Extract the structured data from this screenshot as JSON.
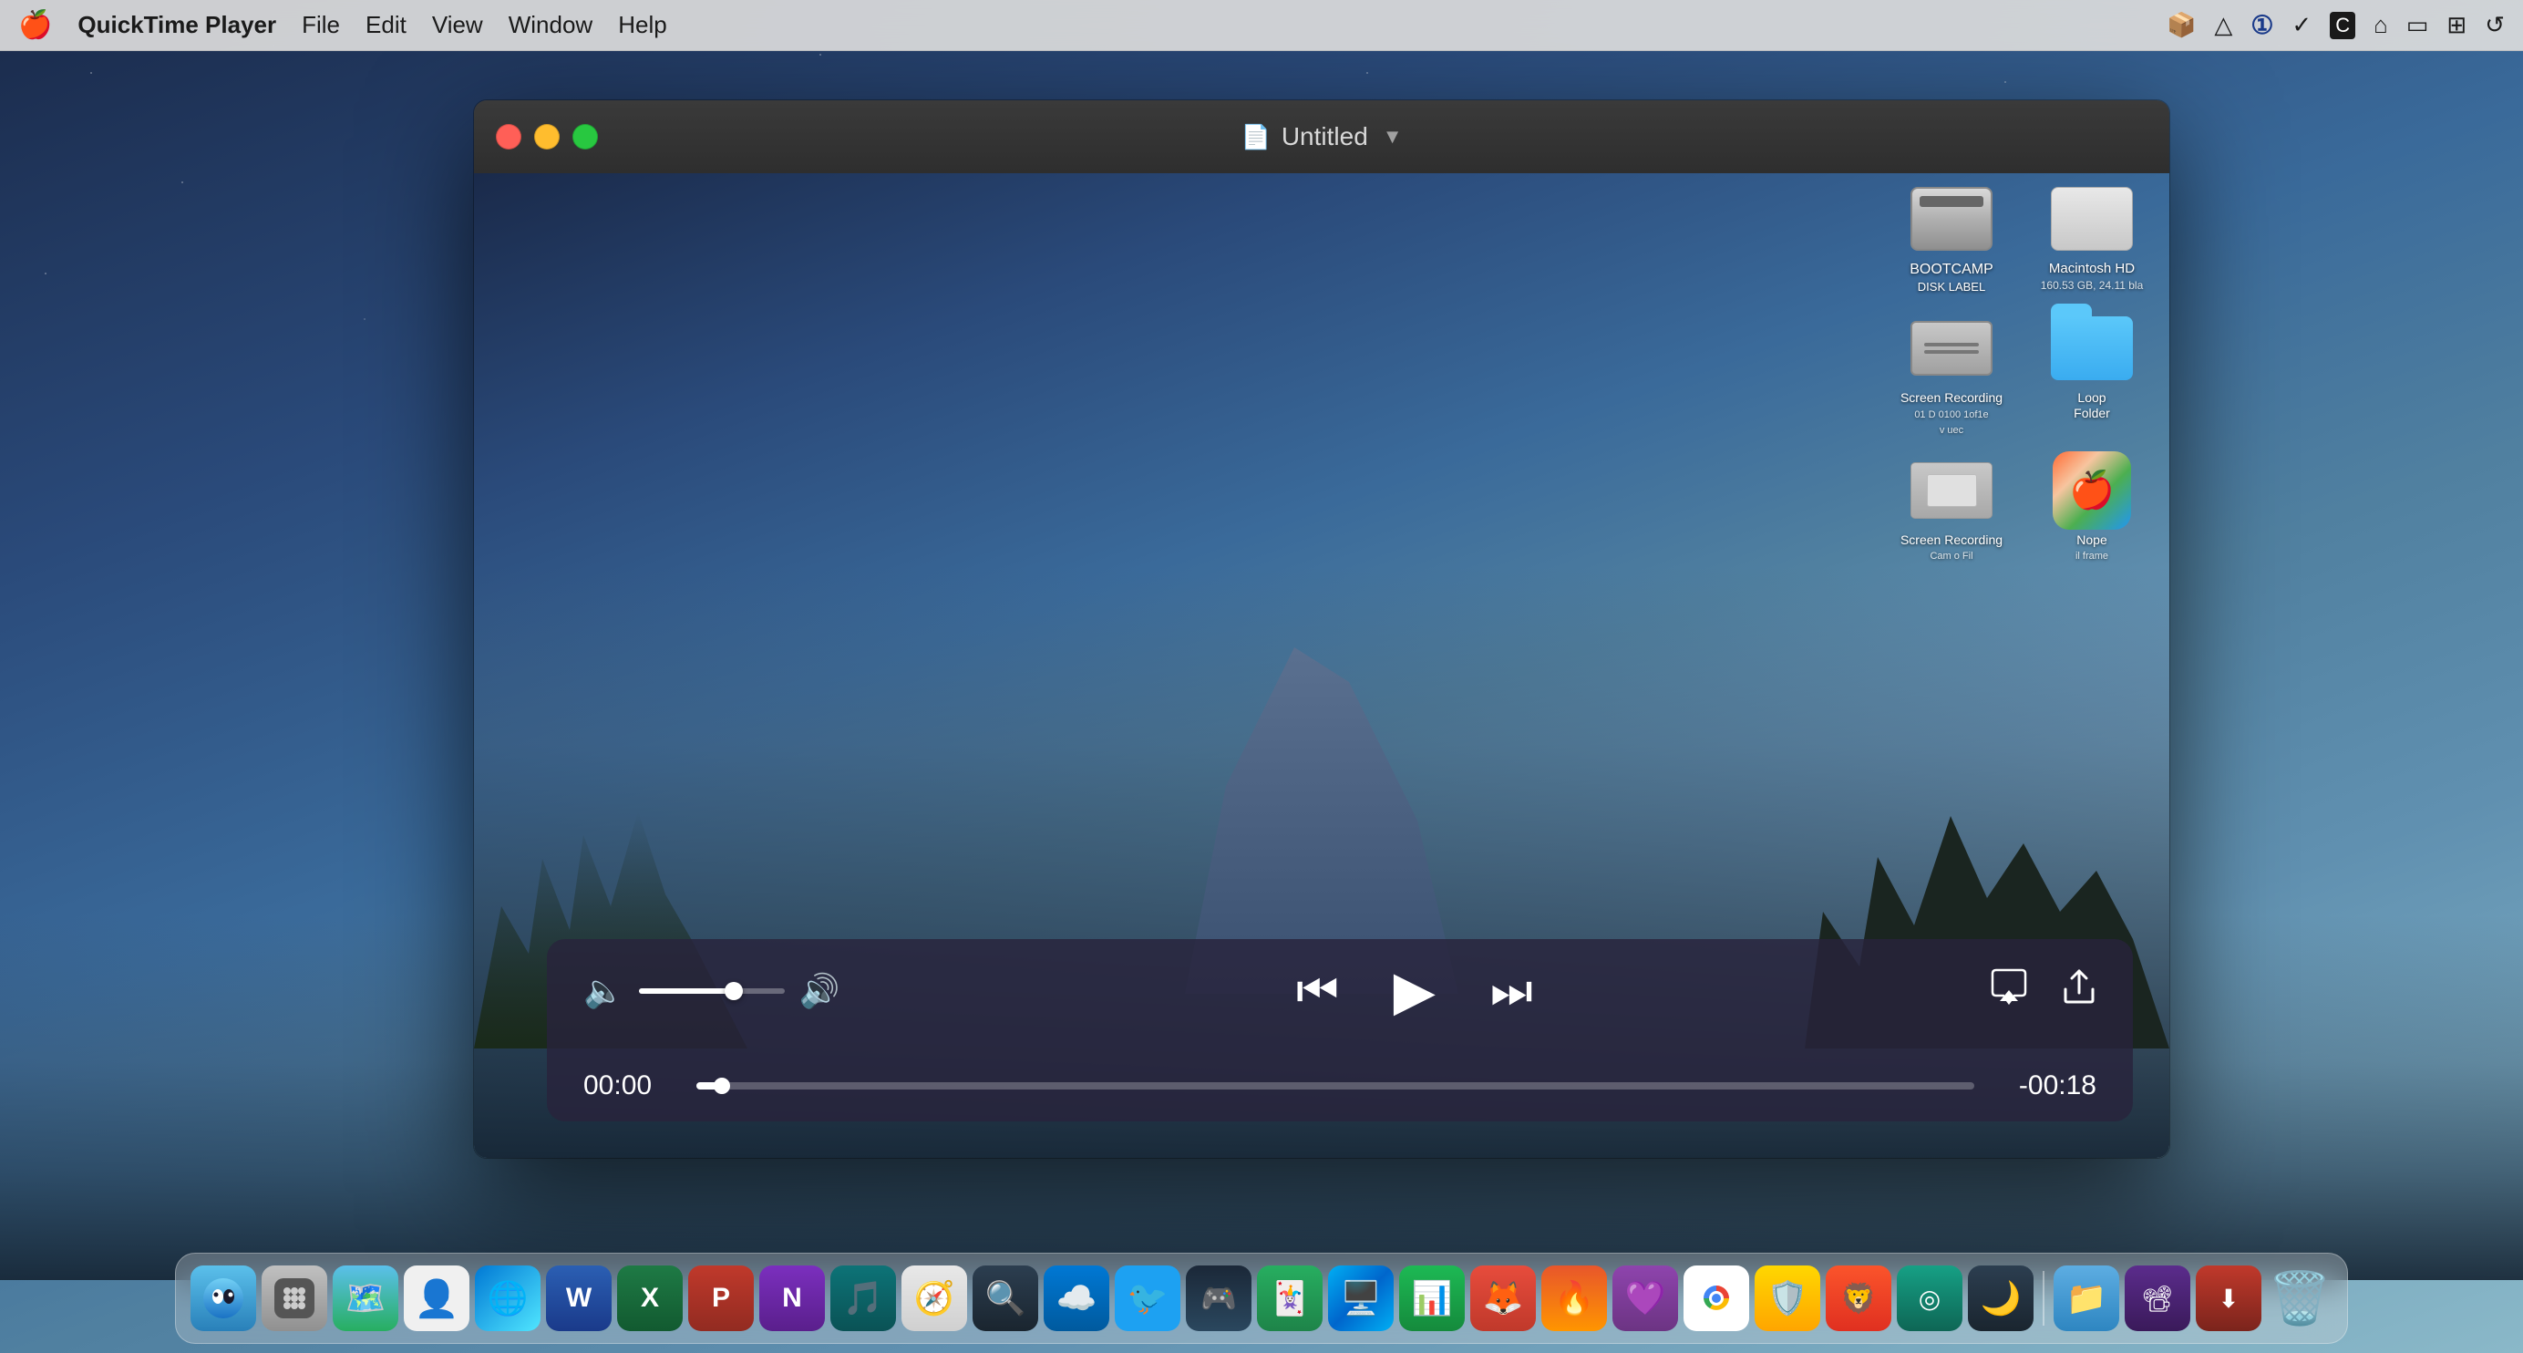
{
  "menubar": {
    "apple": "🍎",
    "app_name": "QuickTime Player",
    "menus": [
      "File",
      "Edit",
      "View",
      "Window",
      "Help"
    ],
    "icons": [
      "📦",
      "△",
      "①",
      "✓",
      "©",
      "⌂",
      "▭",
      "⊞",
      "↺"
    ]
  },
  "window": {
    "title": "Untitled",
    "title_icon": "📄",
    "close_label": "close",
    "minimize_label": "minimize",
    "maximize_label": "maximize"
  },
  "controls": {
    "time_current": "00:00",
    "time_remaining": "-00:18",
    "play_btn": "▶",
    "rewind_btn": "⏪",
    "fastforward_btn": "⏩",
    "volume_icon": "🔈",
    "volume_high_icon": "🔊",
    "airplay_label": "AirPlay",
    "share_label": "Share"
  },
  "desktop_icons": [
    {
      "row": 0,
      "items": [
        {
          "label": "BOOTCAMP (DISK LABEL)",
          "type": "hd"
        },
        {
          "label": "Macintosh HD 160.53 GB, 24.11 bla",
          "type": "hd_white"
        }
      ]
    },
    {
      "row": 1,
      "items": [
        {
          "label": "Screen Recording 01 D 0100 1of1e v uec",
          "type": "screen_rec"
        },
        {
          "label": "Loop Folder",
          "type": "folder"
        }
      ]
    },
    {
      "row": 2,
      "items": [
        {
          "label": "Screen Recording Cam o Fil",
          "type": "screen_rec2"
        },
        {
          "label": "Nope il frame",
          "type": "app_colorful"
        }
      ]
    }
  ],
  "dock": {
    "items": [
      {
        "label": "Finder",
        "class": "dock-finder"
      },
      {
        "label": "Launchpad",
        "class": "dock-launchpad"
      },
      {
        "label": "Maps",
        "class": "dock-maps"
      },
      {
        "label": "Contacts",
        "class": "dock-contacts"
      },
      {
        "label": "Photos",
        "class": "dock-photos"
      },
      {
        "label": "Word",
        "class": "dock-word"
      },
      {
        "label": "Excel",
        "class": "dock-excel"
      },
      {
        "label": "PowerPoint",
        "class": "dock-powerpoint"
      },
      {
        "label": "OneNote",
        "class": "dock-onenote"
      },
      {
        "label": "Groove",
        "class": "dock-groove"
      },
      {
        "label": "Safari",
        "class": "dock-safari"
      },
      {
        "label": "Finder2",
        "class": "dock-finder2"
      },
      {
        "label": "OneDrive",
        "class": "dock-onedrive"
      },
      {
        "label": "Twitter",
        "class": "dock-twitter"
      },
      {
        "label": "Steam",
        "class": "dock-steam"
      },
      {
        "label": "Solitaire",
        "class": "dock-solitaire"
      },
      {
        "label": "Windows",
        "class": "dock-windows"
      },
      {
        "label": "Chart",
        "class": "dock-chart"
      },
      {
        "label": "Misc1",
        "class": "dock-misc1"
      },
      {
        "label": "Firefox",
        "class": "dock-firefox"
      },
      {
        "label": "Other",
        "class": "dock-other"
      },
      {
        "label": "Chrome",
        "class": "dock-chrome"
      },
      {
        "label": "Norton",
        "class": "dock-norton"
      },
      {
        "label": "Brave",
        "class": "dock-brave"
      },
      {
        "label": "Misc2",
        "class": "dock-misc2"
      },
      {
        "label": "Dark",
        "class": "dock-dark"
      },
      {
        "label": "FinderApp",
        "class": "dock-finderapp"
      },
      {
        "label": "Screenium",
        "class": "dock-screenium"
      },
      {
        "label": "Downie",
        "class": "dock-downie"
      },
      {
        "label": "Trash",
        "class": "dock-trash"
      }
    ]
  }
}
